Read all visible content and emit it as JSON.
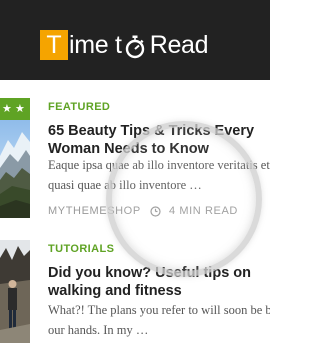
{
  "site": {
    "logo_initial": "T",
    "logo_word_1": "ime t",
    "logo_word_2": "Read",
    "colors": {
      "header_bg": "#222222",
      "accent_orange": "#f5a400",
      "accent_green": "#5fa324"
    }
  },
  "articles": [
    {
      "rating_stars": "★★",
      "category": "FEATURED",
      "title": "65 Beauty Tips & Tricks Every",
      "title_line2": "Woman Needs to Know",
      "excerpt_line1": "Eaque ipsa quae ab illo inventore veritatis et",
      "excerpt_line2": "quasi quae ab illo inventore …",
      "author": "MYTHEMESHOP",
      "read_time": "4 MIN READ"
    },
    {
      "category": "TUTORIALS",
      "title": "Did you know? Useful tips on",
      "title_line2": "walking and fitness",
      "excerpt_line1": "What?! The plans you refer to will soon be back in",
      "excerpt_line2": "our hands. In my …"
    }
  ],
  "icons": {
    "logo_o": "stopwatch-icon",
    "read_time": "clock-icon",
    "rating": "star-icon"
  }
}
